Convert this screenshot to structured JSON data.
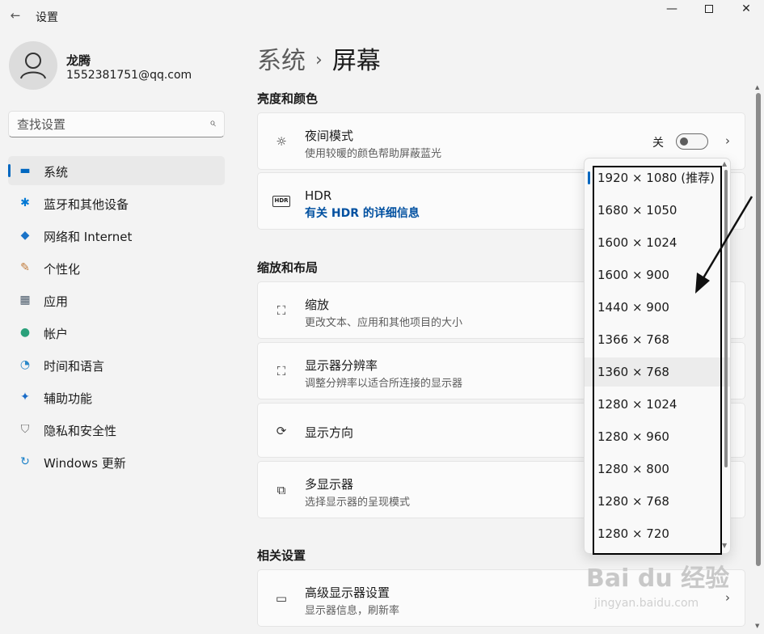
{
  "window": {
    "title": "设置",
    "back": "←",
    "minimize": "—",
    "close": "✕"
  },
  "user": {
    "name": "龙腾",
    "email": "1552381751@qq.com"
  },
  "search": {
    "placeholder": "查找设置",
    "icon": "⌕"
  },
  "sidebar": {
    "items": [
      {
        "label": "系统",
        "icon": "▬",
        "icon_color": "#0067c0",
        "icon_name": "monitor-icon"
      },
      {
        "label": "蓝牙和其他设备",
        "icon": "✱",
        "icon_color": "#0078d4",
        "icon_name": "bluetooth-icon"
      },
      {
        "label": "网络和 Internet",
        "icon": "◆",
        "icon_color": "#1a73c8",
        "icon_name": "wifi-icon"
      },
      {
        "label": "个性化",
        "icon": "✎",
        "icon_color": "#c07a3a",
        "icon_name": "brush-icon"
      },
      {
        "label": "应用",
        "icon": "▦",
        "icon_color": "#4a5a6a",
        "icon_name": "apps-icon"
      },
      {
        "label": "帐户",
        "icon": "●",
        "icon_color": "#2aa07a",
        "icon_name": "account-icon"
      },
      {
        "label": "时间和语言",
        "icon": "◔",
        "icon_color": "#2a88c8",
        "icon_name": "globe-clock-icon"
      },
      {
        "label": "辅助功能",
        "icon": "✦",
        "icon_color": "#1a6cc8",
        "icon_name": "accessibility-icon"
      },
      {
        "label": "隐私和安全性",
        "icon": "⛉",
        "icon_color": "#6a6a6a",
        "icon_name": "shield-icon"
      },
      {
        "label": "Windows 更新",
        "icon": "↻",
        "icon_color": "#1a80c8",
        "icon_name": "update-icon"
      }
    ]
  },
  "breadcrumb": {
    "parent": "系统",
    "separator": "›",
    "current": "屏幕"
  },
  "sections": {
    "brightness": "亮度和颜色",
    "scale_layout": "缩放和布局",
    "related": "相关设置"
  },
  "cards": {
    "night": {
      "title": "夜间模式",
      "desc": "使用较暖的颜色帮助屏蔽蓝光",
      "toggle_label": "关",
      "icon": "☼"
    },
    "hdr": {
      "title": "HDR",
      "link": "有关 HDR 的详细信息",
      "icon": "HDR"
    },
    "scale": {
      "title": "缩放",
      "desc": "更改文本、应用和其他项目的大小",
      "icon": "⛶"
    },
    "resolution": {
      "title": "显示器分辨率",
      "desc": "调整分辨率以适合所连接的显示器",
      "icon": "⛶"
    },
    "orientation": {
      "title": "显示方向",
      "icon": "⟳"
    },
    "multi": {
      "title": "多显示器",
      "desc": "选择显示器的呈现模式",
      "icon": "⧉"
    },
    "advanced": {
      "title": "高级显示器设置",
      "desc": "显示器信息，刷新率",
      "icon": "▭"
    },
    "chevron": "›"
  },
  "resolution_options": [
    "1920 × 1080 (推荐)",
    "1680 × 1050",
    "1600 × 1024",
    "1600 × 900",
    "1440 × 900",
    "1366 × 768",
    "1360 × 768",
    "1280 × 1024",
    "1280 × 960",
    "1280 × 800",
    "1280 × 768",
    "1280 × 720"
  ],
  "watermark": {
    "brand": "Bai du 经验",
    "url": "jingyan.baidu.com"
  }
}
